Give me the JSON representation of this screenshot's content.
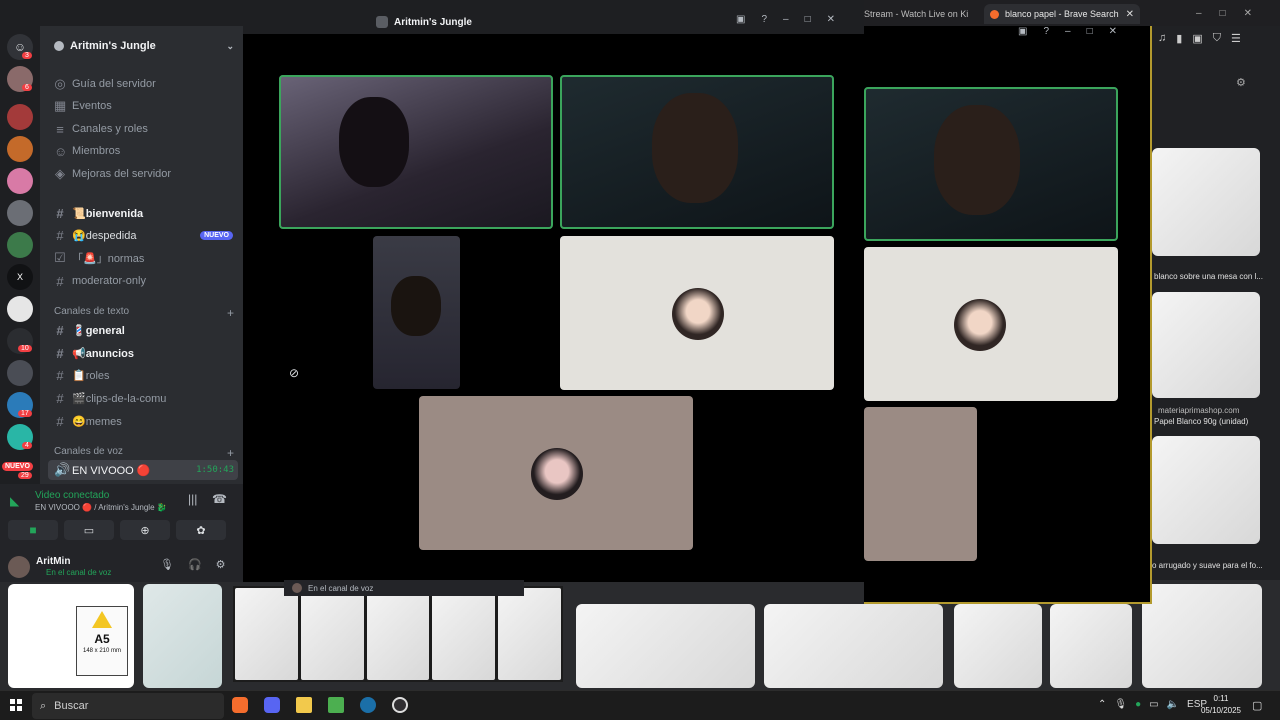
{
  "browser": {
    "tab_active": "blanco papel - Brave Search",
    "tab_other": "Stream - Watch Live on Ki",
    "results": [
      {
        "caption": "blanco sobre una mesa con l..."
      },
      {
        "source": "materiaprimashop.com",
        "caption": "Papel Blanco 90g (unidad)"
      },
      {
        "caption": "o arrugado y suave para el fo..."
      }
    ],
    "strip": {
      "badge_size": "A5",
      "badge_dims": "148 x 210 mm"
    }
  },
  "window": {
    "title": "Aritmin's Jungle"
  },
  "sidebar": {
    "server_name": "Aritmin's Jungle",
    "servers_badges": [
      "3",
      "6",
      "10",
      "17",
      "4",
      "29"
    ],
    "nuevo_label": "NUEVO",
    "top_items": [
      {
        "label": "Guía del servidor",
        "icon": "compass-icon"
      },
      {
        "label": "Eventos",
        "icon": "calendar-icon"
      },
      {
        "label": "Canales y roles",
        "icon": "list-icon"
      },
      {
        "label": "Miembros",
        "icon": "people-icon"
      },
      {
        "label": "Mejoras del servidor",
        "icon": "boost-icon"
      }
    ],
    "channels_top": [
      {
        "label": "📜bienvenida",
        "bold": true
      },
      {
        "label": "😭despedida",
        "badge": "NUEVO"
      },
      {
        "label": "「🚨」normas"
      },
      {
        "label": "moderator-only"
      }
    ],
    "text_category": "Canales de texto",
    "channels_text": [
      {
        "label": "💈general",
        "bold": true
      },
      {
        "label": "📢anuncios",
        "bold": true
      },
      {
        "label": "📋roles"
      },
      {
        "label": "🎬clips-de-la-comu"
      },
      {
        "label": "😄memes"
      }
    ],
    "voice_category": "Canales de voz",
    "voice_channel": {
      "label": "EN VIVOOO 🔴",
      "time": "1:50:43"
    }
  },
  "voice_panel": {
    "status": "Video conectado",
    "location": "EN VIVOOO 🔴 / Aritmin's Jungle 🐉",
    "user": "AritMin",
    "user_status": "En el canal de voz"
  },
  "stage": {
    "overflow_text": "En el canal de voz"
  },
  "taskbar": {
    "search_placeholder": "Buscar",
    "lang": "ESP",
    "time": "0:11",
    "date": "05/10/2025"
  }
}
